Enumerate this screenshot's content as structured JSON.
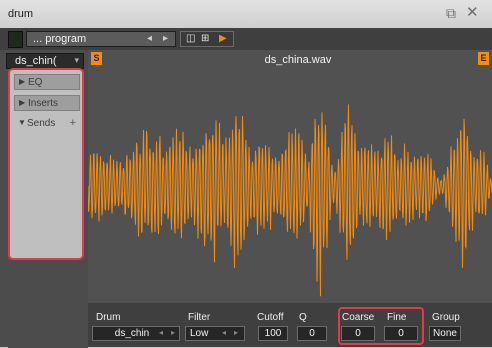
{
  "window": {
    "title": "drum"
  },
  "toolbar": {
    "program_label": "... program"
  },
  "left_panel": {
    "drum_select": "ds_chin(",
    "sections": [
      {
        "label": "EQ"
      },
      {
        "label": "Inserts"
      },
      {
        "label": "Sends"
      }
    ]
  },
  "wave": {
    "file_name": "ds_china.wav",
    "badge_start": "S",
    "badge_end": "E",
    "color": "#f08c12"
  },
  "params": {
    "drum": {
      "label": "Drum",
      "value": "ds_chin"
    },
    "filter": {
      "label": "Filter",
      "value": "Low"
    },
    "cutoff": {
      "label": "Cutoff",
      "value": "100"
    },
    "q": {
      "label": "Q",
      "value": "0"
    },
    "coarse": {
      "label": "Coarse",
      "value": "0"
    },
    "fine": {
      "label": "Fine",
      "value": "0"
    },
    "group": {
      "label": "Group",
      "value": "None"
    }
  },
  "colors": {
    "accent": "#f08c12",
    "highlight": "#e13a4e"
  }
}
